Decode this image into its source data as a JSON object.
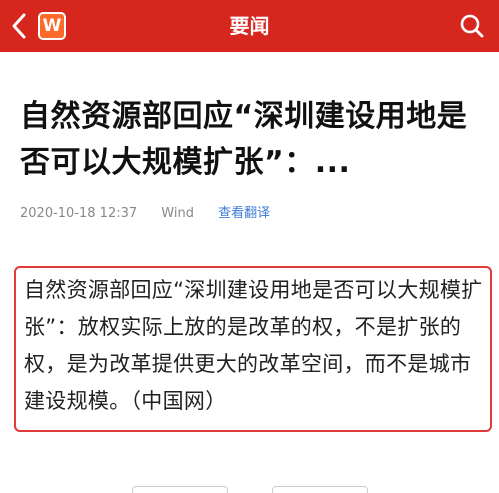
{
  "nav": {
    "title": "要闻",
    "back_icon": "chevron-left-icon",
    "logo_text": "W",
    "search_icon": "search-icon",
    "bar_color": "#d7261e"
  },
  "article": {
    "headline": "自然资源部回应“深圳建设用地是否可以大规模扩张”：...",
    "datetime": "2020-10-18 12:37",
    "source": "Wind",
    "translate_label": "查看翻译",
    "quote": "自然资源部回应“深圳建设用地是否可以大规模扩张”：放权实际上放的是改革的权，不是扩张的权，是为改革提供更大的改革空间，而不是城市建设规模。（中国网）",
    "quote_border_color": "#e03a3a"
  }
}
